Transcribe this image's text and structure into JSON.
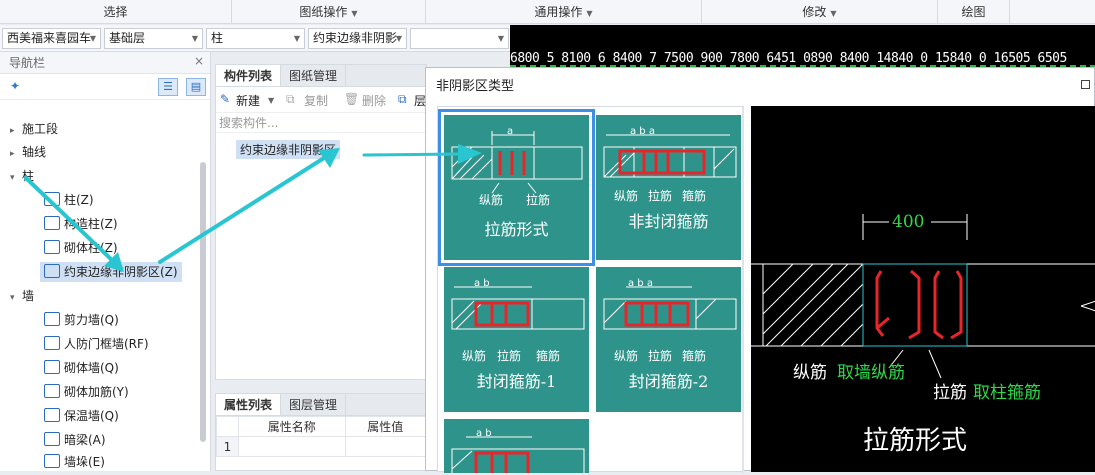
{
  "ribbon": {
    "groups": [
      "选择",
      "图纸操作",
      "通用操作",
      "修改",
      "绘图"
    ]
  },
  "selectors": [
    "西美福来喜园车",
    "基础层",
    "柱",
    "约束边缘非阴影",
    ""
  ],
  "cad_top": {
    "numbers": "6800 5 8100 6 8400 7 7500 900 7800 6451 0890 8400 14840 0 15840 0 16505 6505"
  },
  "nav": {
    "title": "导航栏",
    "close": "×",
    "tree": [
      {
        "label": "施工段",
        "expand": "▸"
      },
      {
        "label": "轴线",
        "expand": "▸"
      },
      {
        "label": "柱",
        "expand": "▾"
      },
      {
        "label": "柱(Z)"
      },
      {
        "label": "构造柱(Z)"
      },
      {
        "label": "砌体柱(Z)"
      },
      {
        "label": "约束边缘非阴影区(Z)"
      },
      {
        "label": "墙",
        "expand": "▾"
      },
      {
        "label": "剪力墙(Q)"
      },
      {
        "label": "人防门框墙(RF)"
      },
      {
        "label": "砌体墙(Q)"
      },
      {
        "label": "砌体加筋(Y)"
      },
      {
        "label": "保温墙(Q)"
      },
      {
        "label": "暗梁(A)"
      },
      {
        "label": "墙垛(E)"
      }
    ]
  },
  "components": {
    "tabs": [
      "构件列表",
      "图纸管理"
    ],
    "close": "×",
    "toolbar": {
      "new": "新建",
      "copy": "复制",
      "delete": "删除",
      "more": "层"
    },
    "search_placeholder": "搜索构件...",
    "items": [
      "约束边缘非阴影区"
    ]
  },
  "properties": {
    "tabs": [
      "属性列表",
      "图层管理"
    ],
    "columns": [
      "属性名称",
      "属性值"
    ],
    "rows": [
      "1"
    ]
  },
  "dialog": {
    "title": "非阴影区类型",
    "cards": [
      {
        "label": "拉筋形式",
        "legend": [
          "纵筋",
          "拉筋"
        ],
        "dim": "a"
      },
      {
        "label": "非封闭箍筋",
        "legend": [
          "纵筋",
          "拉筋",
          "箍筋"
        ],
        "dim": "a b a"
      },
      {
        "label": "封闭箍筋-1",
        "legend": [
          "纵筋",
          "拉筋",
          "箍筋"
        ],
        "dim": "a b"
      },
      {
        "label": "封闭箍筋-2",
        "legend": [
          "纵筋",
          "拉筋",
          "箍筋"
        ],
        "dim": "a b a"
      },
      {
        "label": "",
        "legend": [],
        "dim": "a b"
      }
    ],
    "preview": {
      "dim_value": "400",
      "legend1_prefix": "纵筋",
      "legend1_value": "取墙纵筋",
      "legend2_prefix": "拉筋",
      "legend2_value": "取柱箍筋",
      "title": "拉筋形式"
    }
  },
  "colors": {
    "accent": "#2b6cc1",
    "card_bg": "#2e938a",
    "annotation_arrow": "#29c6d1",
    "rebar_red": "#e8262a",
    "cad_green": "#2fd84a"
  }
}
